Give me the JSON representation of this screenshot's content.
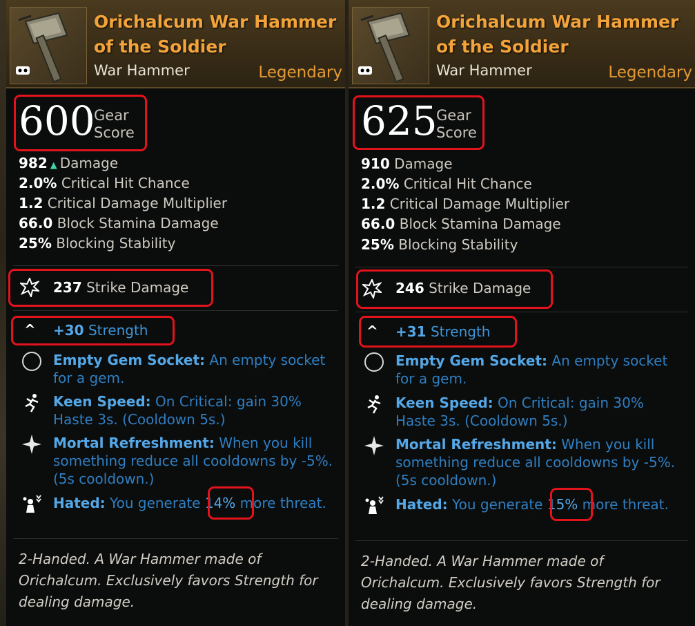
{
  "cards": [
    {
      "title_line1": "Orichalcum War Hammer",
      "title_line2": "of the Soldier",
      "item_type": "War Hammer",
      "rarity": "Legendary",
      "gear_score": "600",
      "gear_score_label_1": "Gear",
      "gear_score_label_2": "Score",
      "stats": [
        {
          "value": "982",
          "label": "Damage",
          "up_arrow": "▲"
        },
        {
          "value": "2.0%",
          "label": "Critical Hit Chance"
        },
        {
          "value": "1.2",
          "label": "Critical Damage Multiplier"
        },
        {
          "value": "66.0",
          "label": "Block Stamina Damage"
        },
        {
          "value": "25%",
          "label": "Blocking Stability"
        }
      ],
      "strike": {
        "value": "237",
        "label": "Strike Damage"
      },
      "attribute": {
        "value": "+30",
        "label": "Strength"
      },
      "perks": [
        {
          "name": "Empty Gem Socket:",
          "desc": "An empty socket for a gem."
        },
        {
          "name": "Keen Speed:",
          "desc": "On Critical: gain 30% Haste 3s. (Cooldown 5s.)"
        },
        {
          "name": "Mortal Refreshment:",
          "desc": "When you kill something reduce all cooldowns by -5%. (5s cooldown.)"
        },
        {
          "name": "Hated:",
          "desc_pre": "You generate",
          "highlight": "14%",
          "desc_post": "more threat."
        }
      ],
      "flavor": "2-Handed. A War Hammer made of Orichalcum. Exclusively favors Strength for dealing damage."
    },
    {
      "title_line1": "Orichalcum War Hammer",
      "title_line2": "of the Soldier",
      "item_type": "War Hammer",
      "rarity": "Legendary",
      "gear_score": "625",
      "gear_score_label_1": "Gear",
      "gear_score_label_2": "Score",
      "stats": [
        {
          "value": "910",
          "label": "Damage"
        },
        {
          "value": "2.0%",
          "label": "Critical Hit Chance"
        },
        {
          "value": "1.2",
          "label": "Critical Damage Multiplier"
        },
        {
          "value": "66.0",
          "label": "Block Stamina Damage"
        },
        {
          "value": "25%",
          "label": "Blocking Stability"
        }
      ],
      "strike": {
        "value": "246",
        "label": "Strike Damage"
      },
      "attribute": {
        "value": "+31",
        "label": "Strength"
      },
      "perks": [
        {
          "name": "Empty Gem Socket:",
          "desc": "An empty socket for a gem."
        },
        {
          "name": "Keen Speed:",
          "desc": "On Critical: gain 30% Haste 3s. (Cooldown 5s.)"
        },
        {
          "name": "Mortal Refreshment:",
          "desc": "When you kill something reduce all cooldowns by -5%. (5s cooldown.)"
        },
        {
          "name": "Hated:",
          "desc_pre": "You generate",
          "highlight": "15%",
          "desc_post": "more threat."
        }
      ],
      "flavor": "2-Handed. A War Hammer made of Orichalcum. Exclusively favors Strength for dealing damage."
    }
  ],
  "colors": {
    "title": "#f2a33a",
    "rarity": "#e39a36",
    "perk_blue": "#2f7fc2",
    "perk_name_blue": "#55a8e8",
    "stat_up_green": "#3fd3a7",
    "annotation_red": "#e3131b"
  },
  "icons": [
    "war-hammer-icon",
    "mask-icon",
    "strike-burst-icon",
    "chevron-up-icon",
    "gem-socket-icon",
    "running-figure-icon",
    "four-point-star-icon",
    "threat-figure-icon"
  ]
}
